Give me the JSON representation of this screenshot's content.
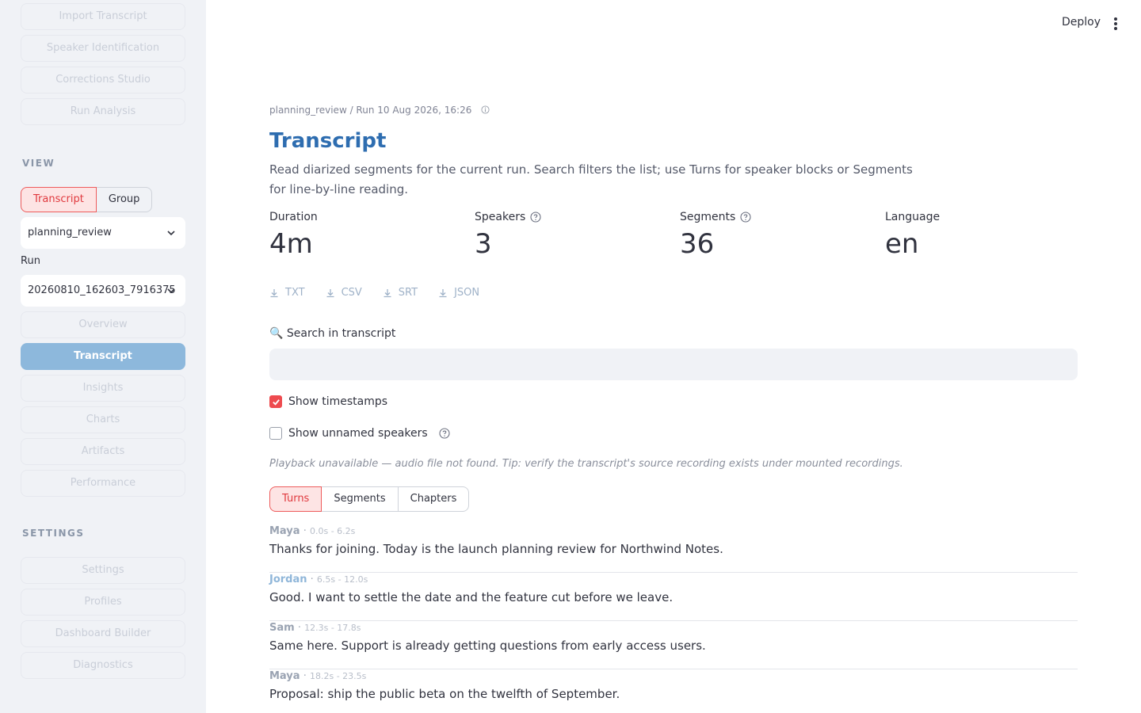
{
  "sidebar": {
    "top_nav": [
      "Import Transcript",
      "Speaker Identification",
      "Corrections Studio",
      "Run Analysis"
    ],
    "view_label": "VIEW",
    "view_toggle": [
      "Transcript",
      "Group"
    ],
    "project_select": "planning_review",
    "run_label": "Run",
    "run_select": "20260810_162603_7916375",
    "view_nav": [
      "Overview",
      "Transcript",
      "Insights",
      "Charts",
      "Artifacts",
      "Performance"
    ],
    "active_item": "Transcript",
    "settings_label": "SETTINGS",
    "settings_nav": [
      "Settings",
      "Profiles",
      "Dashboard Builder",
      "Diagnostics"
    ]
  },
  "header": {
    "deploy_label": "Deploy"
  },
  "main": {
    "breadcrumb": "planning_review / Run 10 Aug 2026, 16:26",
    "title": "Transcript",
    "description": "Read diarized segments for the current run. Search filters the list; use Turns for speaker blocks or Segments for line-by-line reading.",
    "metrics": [
      {
        "label": "Duration",
        "value": "4m"
      },
      {
        "label": "Speakers",
        "value": "3"
      },
      {
        "label": "Segments",
        "value": "36"
      },
      {
        "label": "Language",
        "value": "en"
      }
    ],
    "downloads": [
      "TXT",
      "CSV",
      "SRT",
      "JSON"
    ],
    "search_label": "🔍 Search in transcript",
    "search_value": "",
    "show_timestamps_label": "Show timestamps",
    "show_timestamps_checked": true,
    "show_unnamed_label": "Show unnamed speakers",
    "show_unnamed_checked": false,
    "playback_note": "Playback unavailable — audio file not found. Tip: verify the transcript's source recording exists under mounted recordings.",
    "view_tabs": [
      "Turns",
      "Segments",
      "Chapters"
    ],
    "active_tab": "Turns",
    "turns": [
      {
        "speaker": "Maya",
        "time": "0.0s - 6.2s",
        "text": "Thanks for joining. Today is the launch planning review for Northwind Notes.",
        "color": "#9aa3b2"
      },
      {
        "speaker": "Jordan",
        "time": "6.5s - 12.0s",
        "text": "Good. I want to settle the date and the feature cut before we leave.",
        "color": "#8fb6d9"
      },
      {
        "speaker": "Sam",
        "time": "12.3s - 17.8s",
        "text": "Same here. Support is already getting questions from early access users.",
        "color": "#9aa3b2"
      },
      {
        "speaker": "Maya",
        "time": "18.2s - 23.5s",
        "text": "Proposal: ship the public beta on the twelfth of September.",
        "color": "#9aa3b2"
      }
    ]
  },
  "colors": {
    "accent_red": "#ee4b4f",
    "title_blue": "#2e6db0",
    "active_nav": "#8db8dc",
    "sidebar_bg": "#f0f2f6"
  }
}
